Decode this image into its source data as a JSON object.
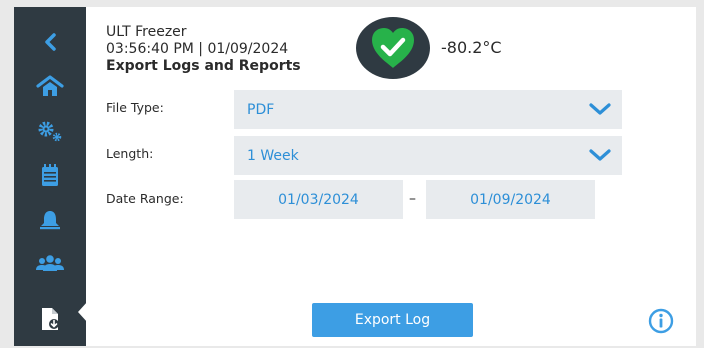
{
  "header": {
    "title": "ULT Freezer",
    "datetime": "03:56:40 PM | 01/09/2024",
    "section": "Export Logs and Reports",
    "temperature": "-80.2°C",
    "status_icon": "heart-check-icon",
    "status_color": "#27b24a"
  },
  "sidebar": {
    "items": [
      {
        "icon": "back-chevron-icon"
      },
      {
        "icon": "home-icon"
      },
      {
        "icon": "settings-gears-icon"
      },
      {
        "icon": "calendar-icon"
      },
      {
        "icon": "bell-icon"
      },
      {
        "icon": "users-icon"
      },
      {
        "icon": "export-file-icon",
        "active": true
      }
    ],
    "background": "#2f3a42",
    "icon_color": "#3d9ee4"
  },
  "form": {
    "file_type": {
      "label": "File Type:",
      "value": "PDF"
    },
    "length": {
      "label": "Length:",
      "value": "1 Week"
    },
    "date_range": {
      "label": "Date Range:",
      "start": "01/03/2024",
      "separator": "–",
      "end": "01/09/2024"
    }
  },
  "actions": {
    "export_label": "Export Log",
    "info_icon": "info-icon"
  },
  "colors": {
    "accent": "#3d9ee4",
    "field_bg": "#e8ebee"
  }
}
